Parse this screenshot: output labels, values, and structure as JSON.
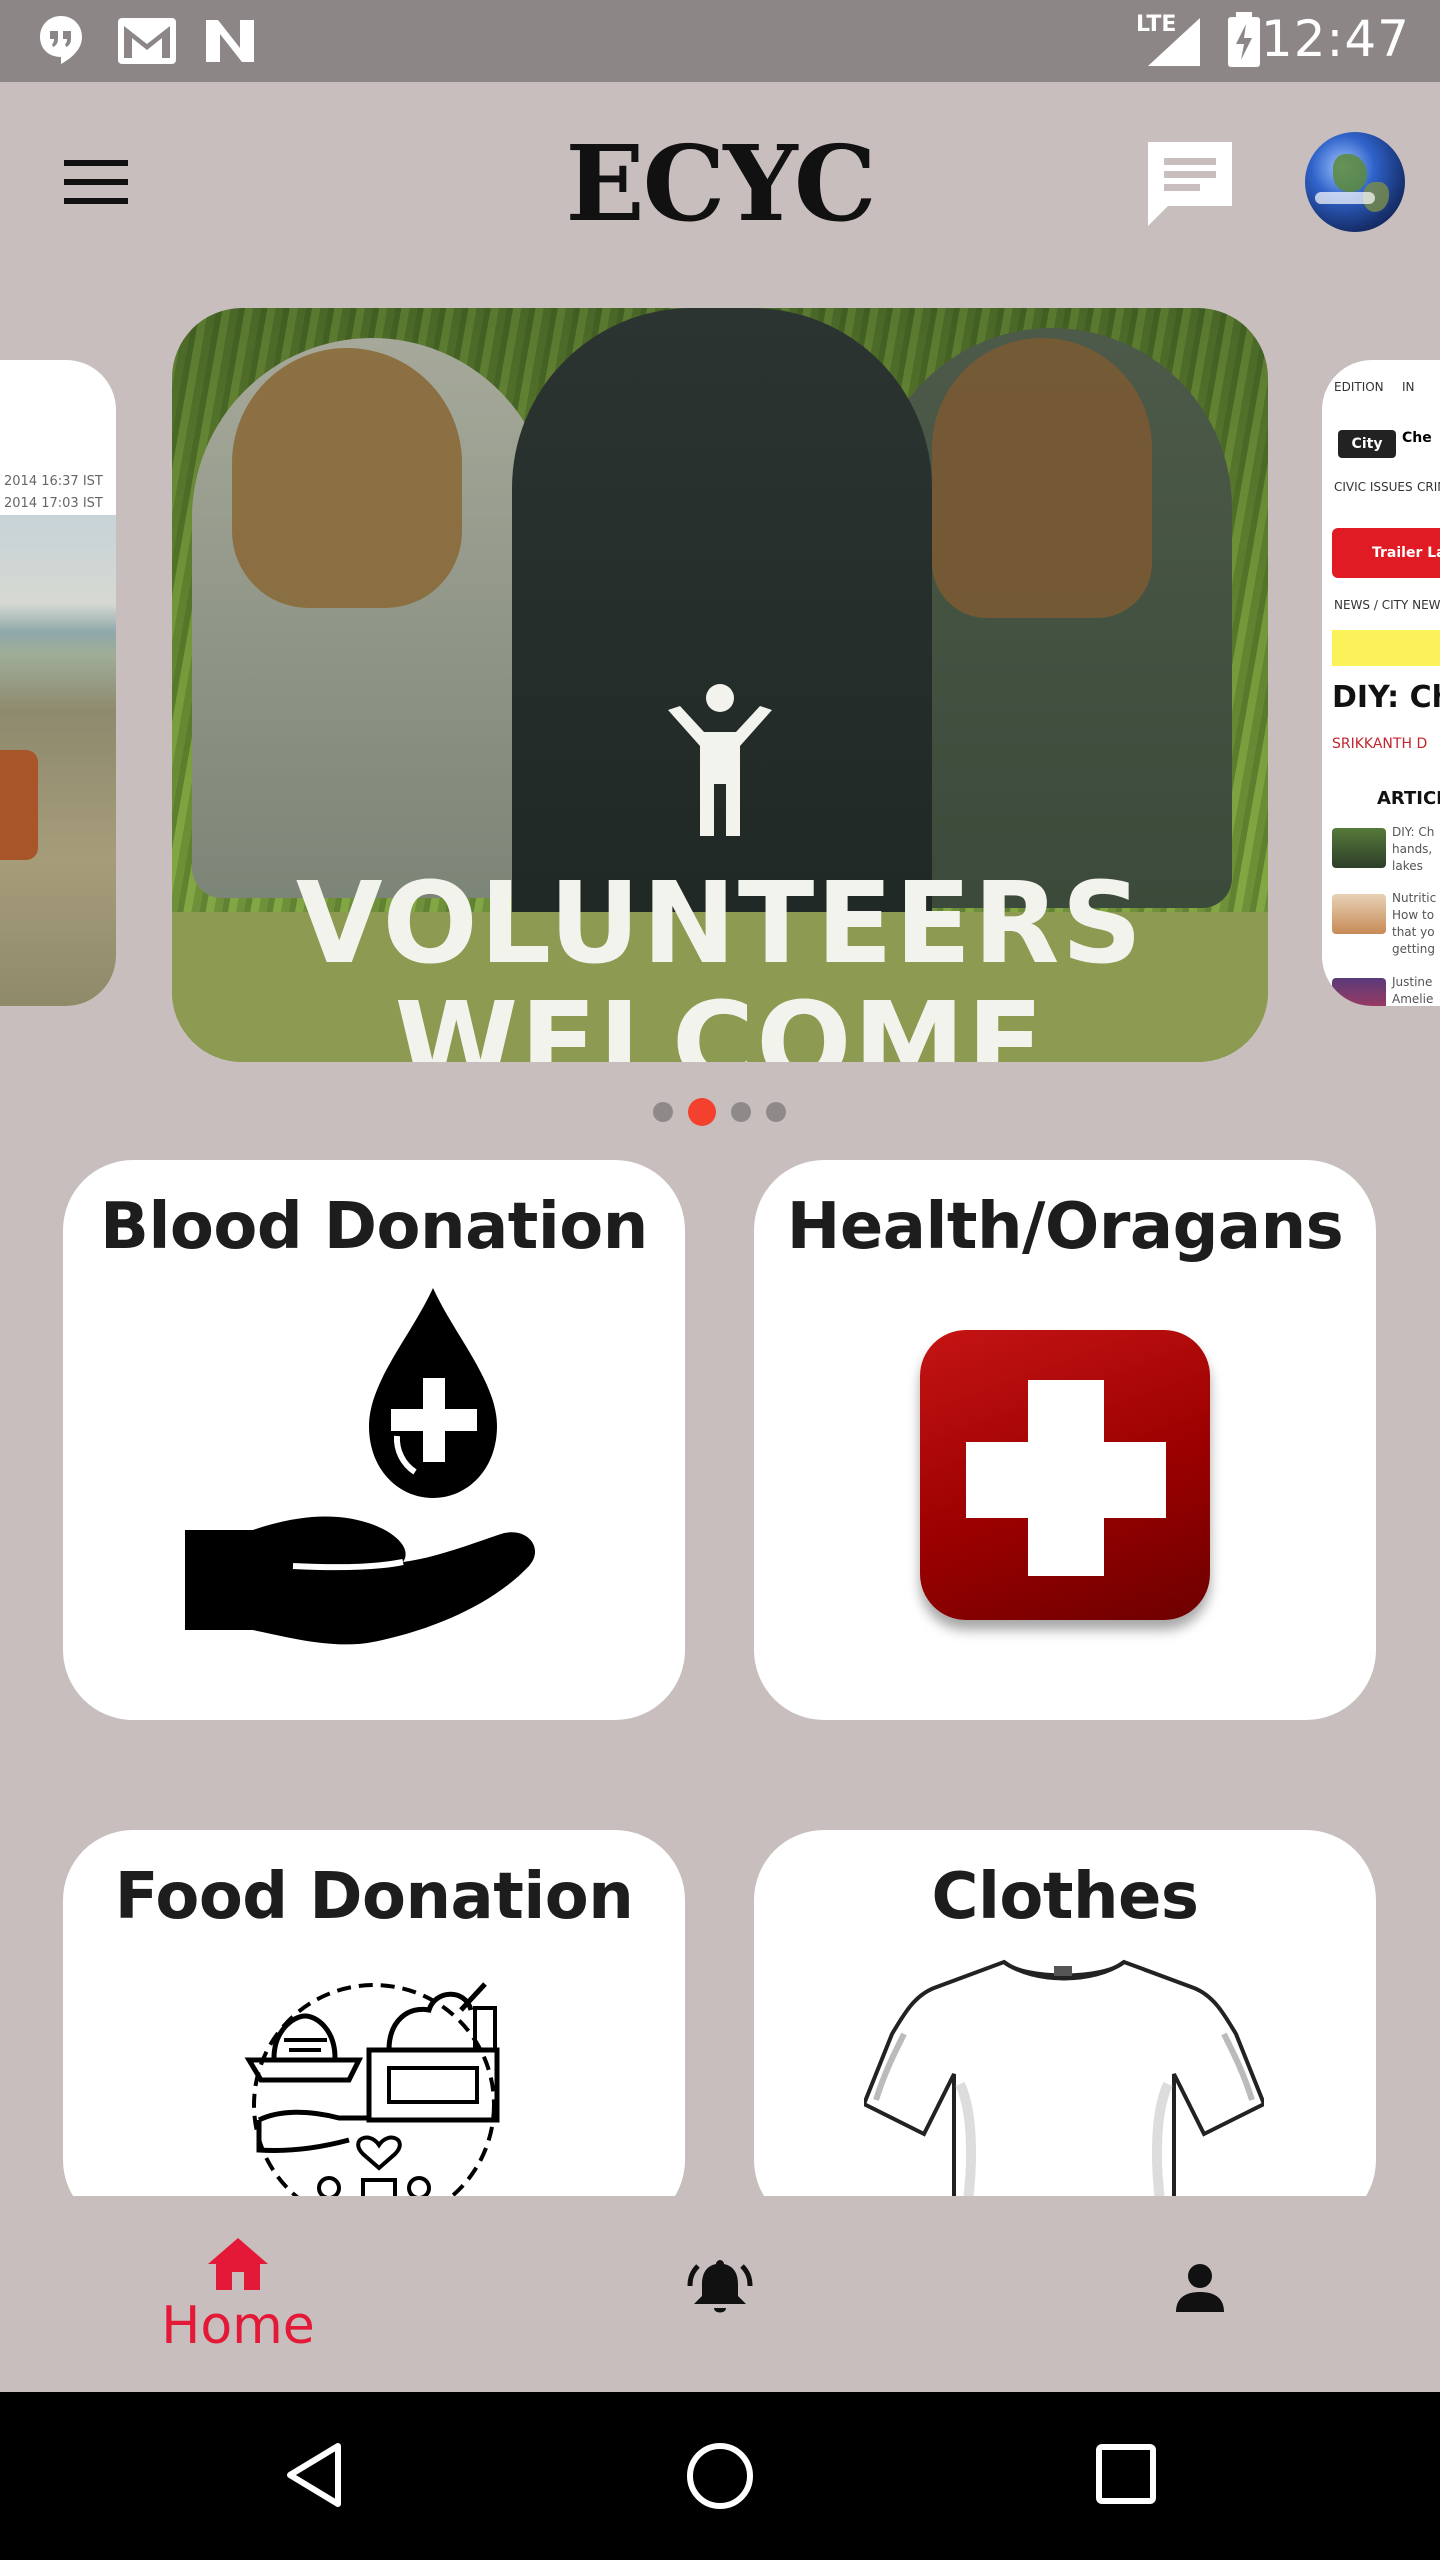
{
  "status_bar": {
    "time": "12:47",
    "network": "LTE",
    "icons": [
      "hangouts-icon",
      "gmail-icon",
      "n-icon",
      "signal-icon",
      "battery-charging-icon"
    ]
  },
  "app_bar": {
    "title": "ECYC",
    "icons": [
      "menu-icon",
      "chat-icon",
      "globe-avatar"
    ]
  },
  "carousel": {
    "main_slide_text_line1": "VOLUNTEERS",
    "main_slide_text_line2": "WELCOME",
    "left_slide": {
      "meta1": "2014 16:37 IST",
      "meta2": "2014 17:03 IST"
    },
    "right_slide": {
      "edition": "EDITION",
      "edition_country": "IN",
      "tab_city": "City",
      "tab_other": "Che",
      "nav1": "CIVIC ISSUES",
      "nav2": "CRIM",
      "trailer": "Trailer Lau",
      "crumb": "NEWS / CITY NEW",
      "headline": "DIY: Ch",
      "author": "SRIKKANTH D",
      "articles_heading": "ARTICL",
      "article1": [
        "DIY: Ch",
        "hands,",
        "lakes"
      ],
      "article2": [
        "Nutritic",
        "How to",
        "that yo",
        "getting"
      ],
      "article3": [
        "Justine",
        "Amelie"
      ]
    },
    "page_count": 4,
    "active_page": 2
  },
  "categories": [
    {
      "title": "Blood Donation",
      "icon": "blood-donation-hand-icon"
    },
    {
      "title": "Health/Oragans",
      "icon": "red-cross-icon"
    },
    {
      "title": "Food Donation",
      "icon": "food-donation-icon"
    },
    {
      "title": "Clothes",
      "icon": "tshirt-icon"
    }
  ],
  "bottom_nav": {
    "home_label": "Home",
    "active_color": "#e31937",
    "items": [
      "home-icon",
      "bell-icon",
      "person-icon"
    ]
  },
  "colors": {
    "background": "#c8bebe",
    "status_bar": "#8d8686",
    "active_dot": "#f4412d"
  }
}
